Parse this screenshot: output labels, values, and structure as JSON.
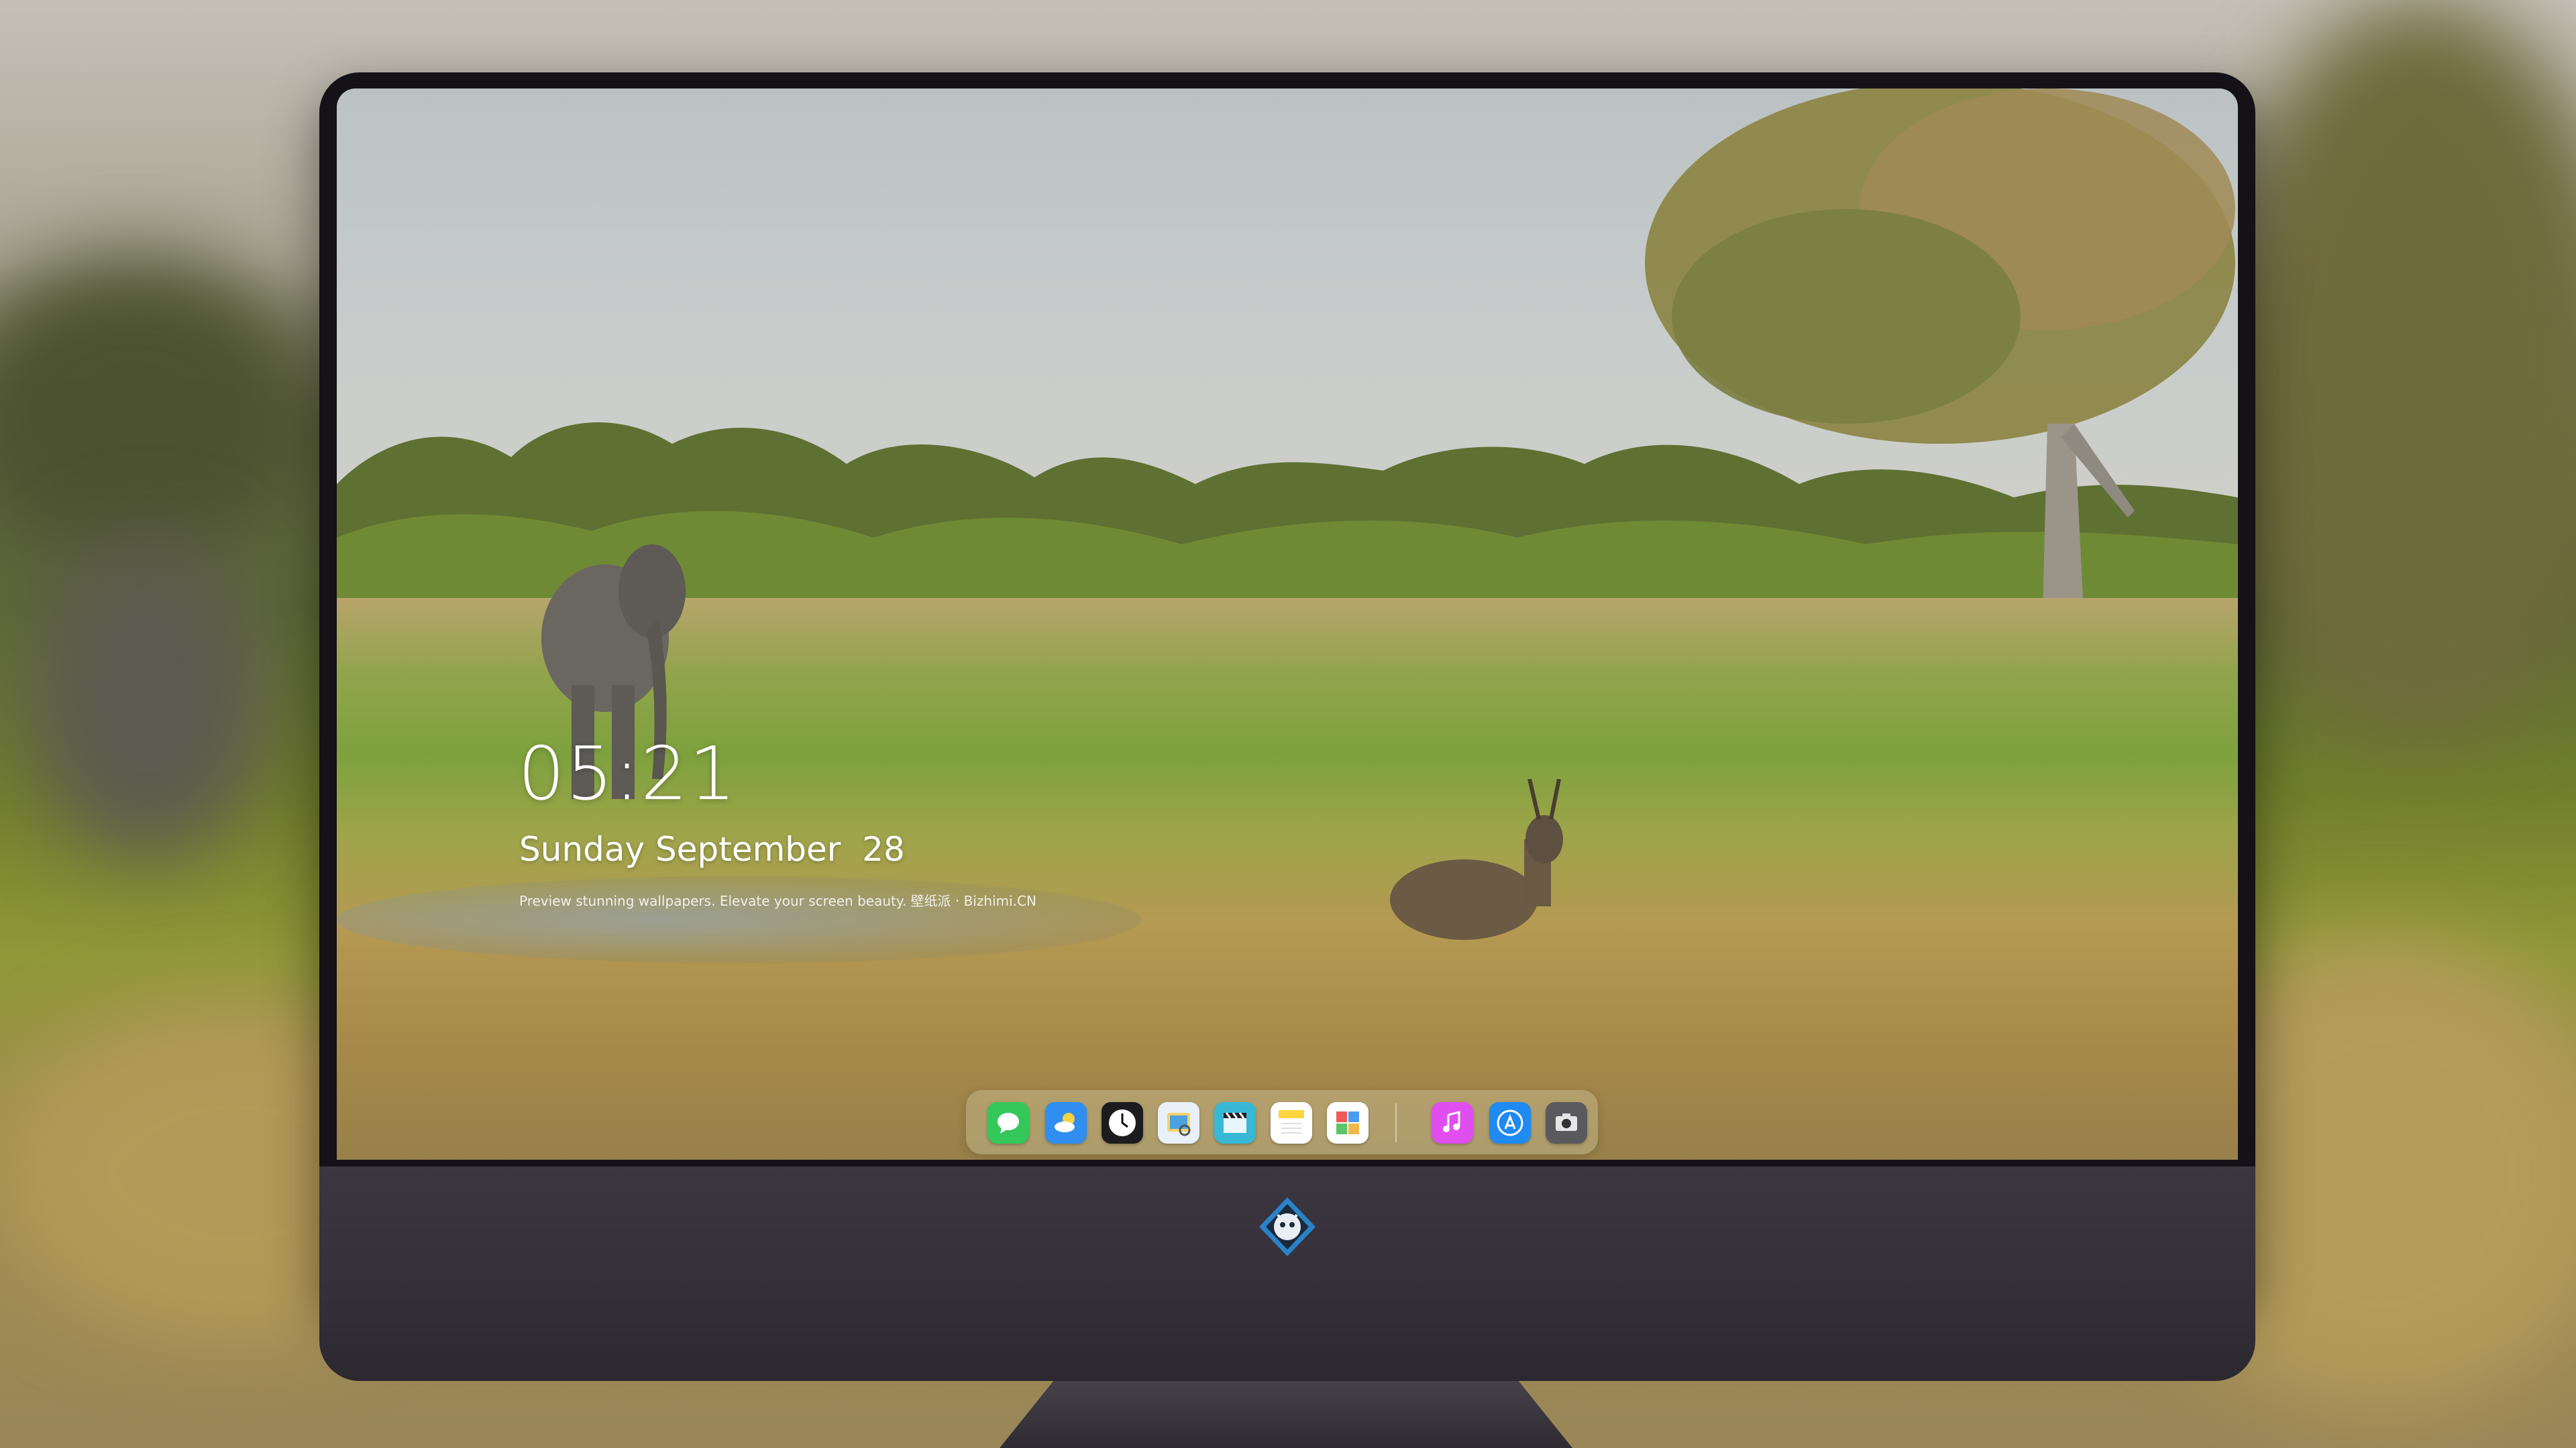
{
  "lock_screen": {
    "time": "05:21",
    "date": "Sunday September  28",
    "caption": "Preview stunning wallpapers. Elevate your screen beauty. 壁纸派 · Bizhimi.CN"
  },
  "dock": {
    "apps": [
      {
        "name": "messages",
        "icon": "messages-icon",
        "color": "#34c759"
      },
      {
        "name": "weather",
        "icon": "weather-icon",
        "color": "#2f8ef0"
      },
      {
        "name": "clock",
        "icon": "clock-icon",
        "color": "#1c1c1e"
      },
      {
        "name": "preview",
        "icon": "preview-icon",
        "color": "#e9f0f8"
      },
      {
        "name": "final-cut",
        "icon": "clapperboard-icon",
        "color": "#37b9d6"
      },
      {
        "name": "notes",
        "icon": "notes-icon",
        "color": "#ffd53d"
      },
      {
        "name": "photo-booth",
        "icon": "photo-booth-icon",
        "color": "#f05a5a"
      },
      {
        "name": "music",
        "icon": "music-icon",
        "color": "#e04ef0"
      },
      {
        "name": "app-store",
        "icon": "app-store-icon",
        "color": "#1f8af2"
      },
      {
        "name": "screenshot",
        "icon": "camera-icon",
        "color": "#5a5a5e"
      }
    ]
  },
  "colors": {
    "monitor_bezel": "#141217",
    "monitor_chin": "#3b3640",
    "sky": "#c8cccb",
    "grass": "#8ea449",
    "text": "#ffffff"
  }
}
